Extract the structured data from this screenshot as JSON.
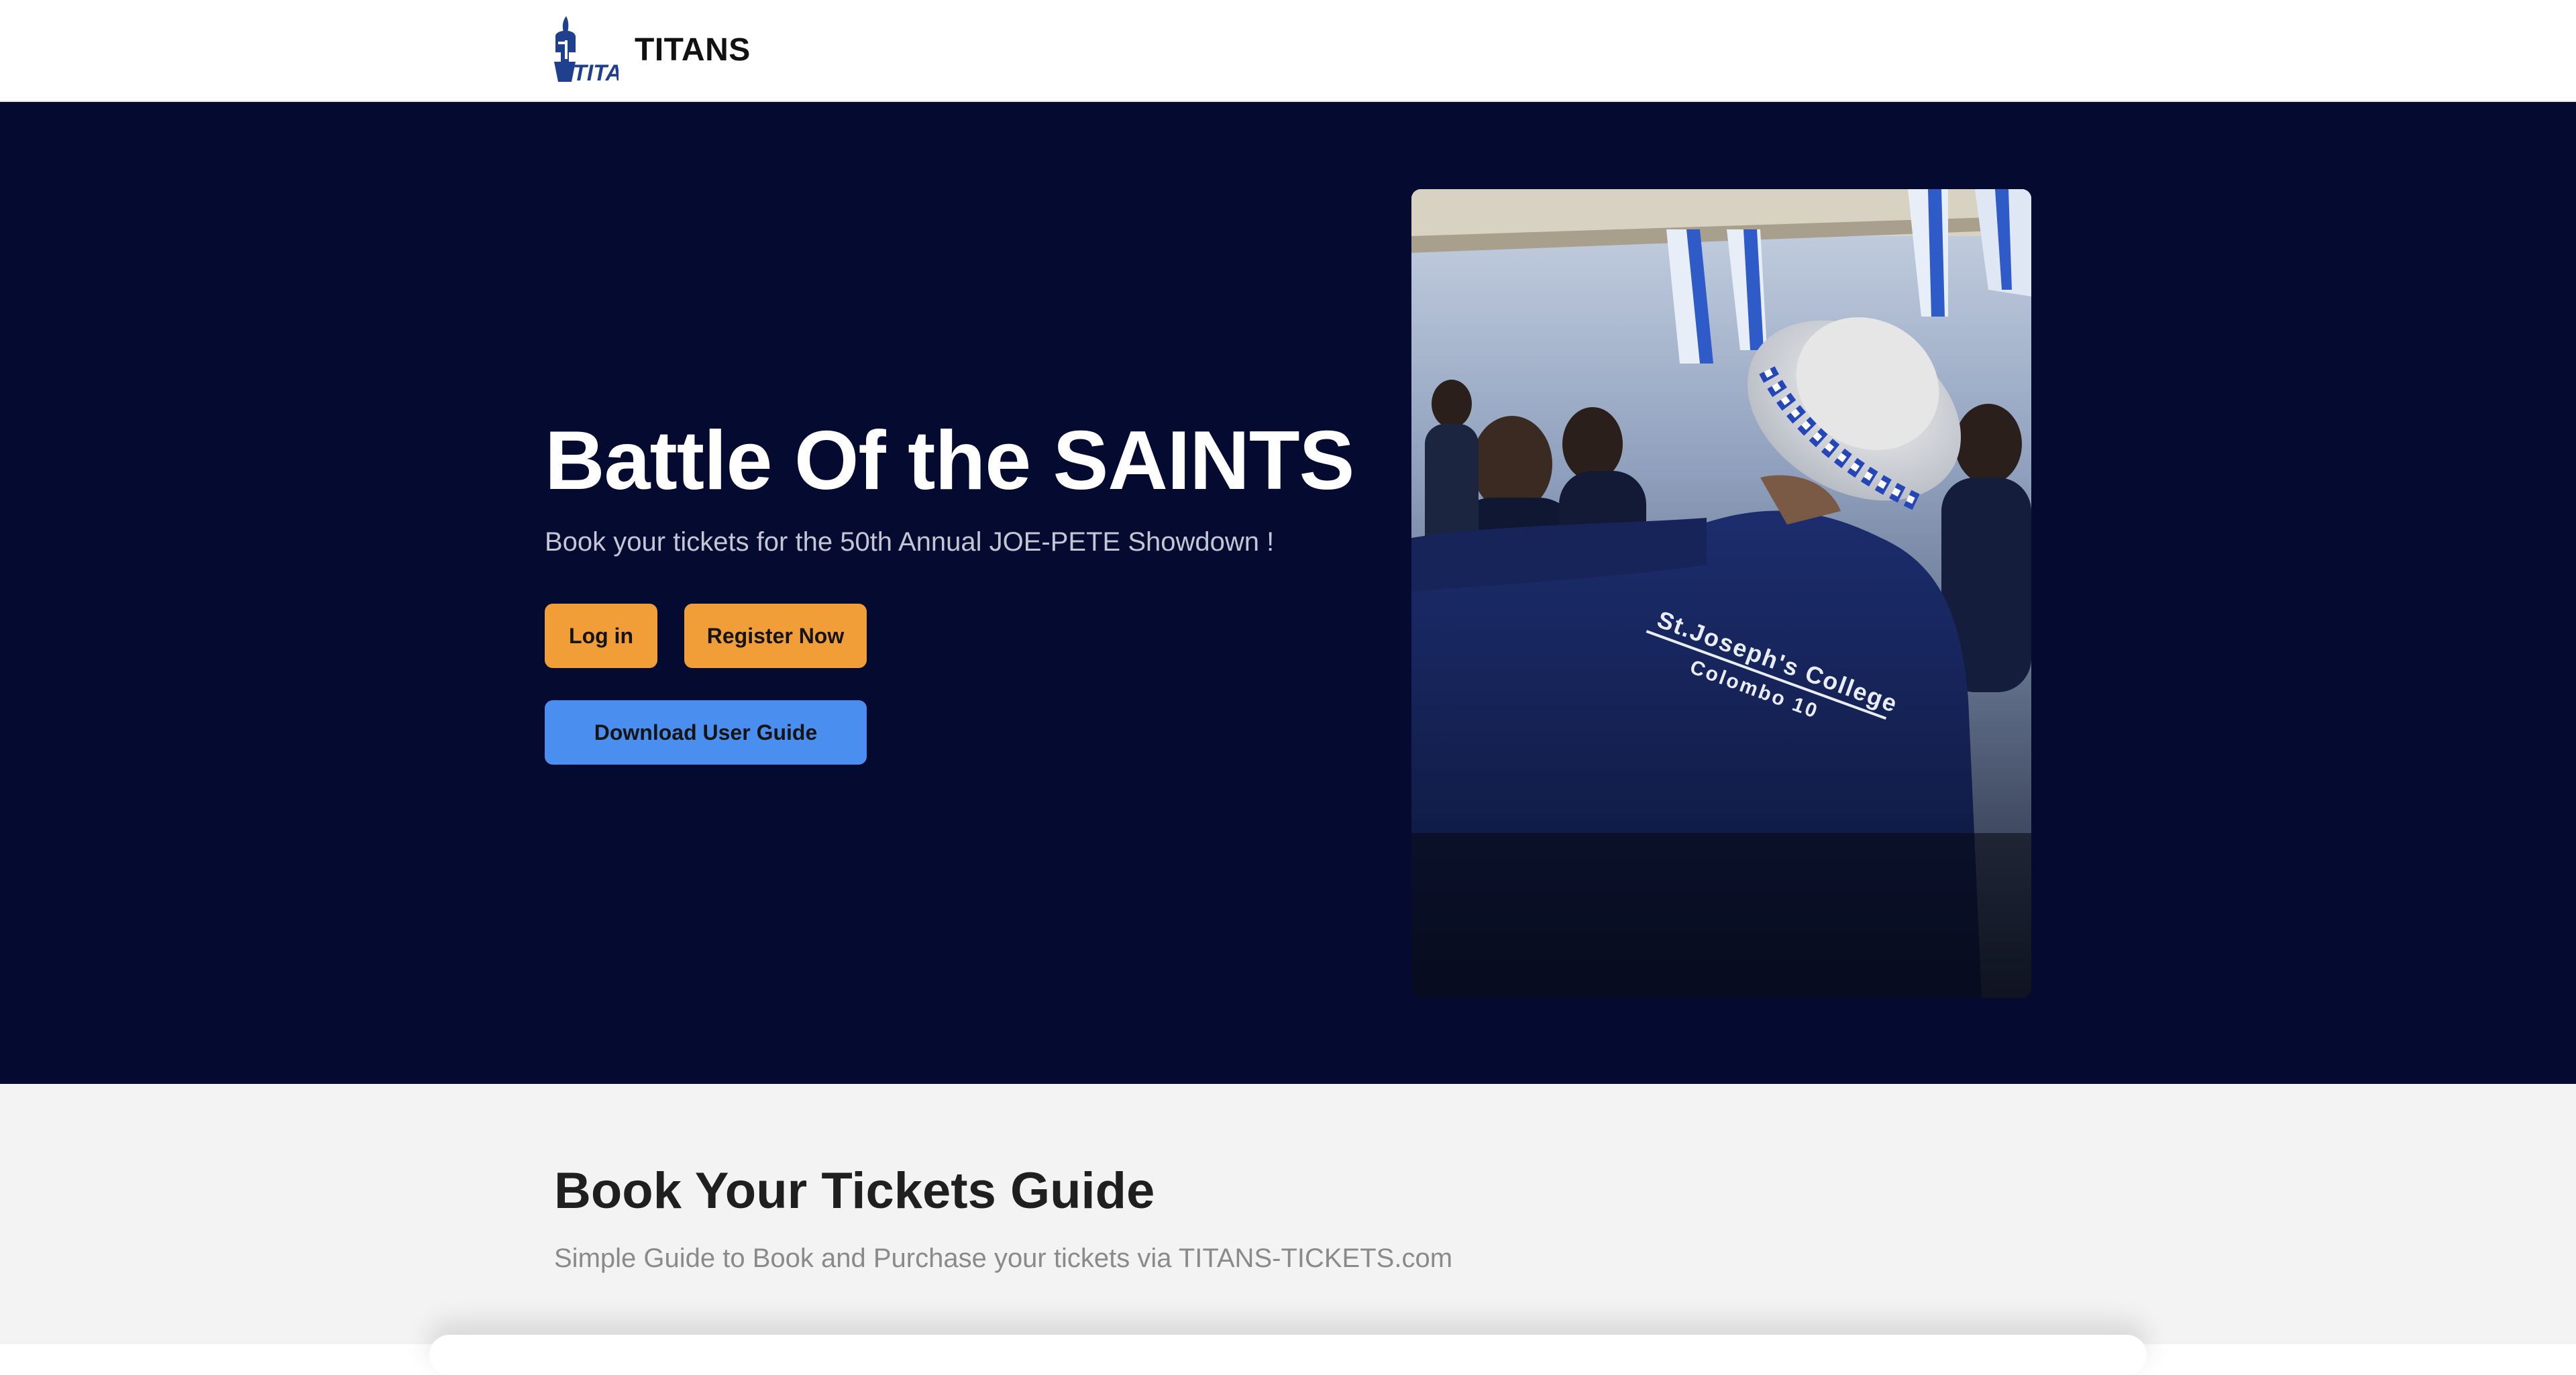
{
  "header": {
    "logo_text": "TITANS",
    "brand_name": "TITANS",
    "logo_icon": "spartan-helmet-icon"
  },
  "hero": {
    "title": "Battle Of the SAINTS",
    "subtitle": "Book your tickets for the 50th Annual JOE-PETE Showdown !",
    "login_label": "Log in",
    "register_label": "Register Now",
    "guide_label": "Download User Guide",
    "photo_jacket_line1": "St.Joseph's College",
    "photo_jacket_line2": "Colombo 10"
  },
  "guide": {
    "title": "Book Your Tickets Guide",
    "subtitle": "Simple Guide to Book and Purchase your tickets via TITANS-TICKETS.com"
  },
  "colors": {
    "hero_background": "#040a30",
    "primary_button": "#f19e38",
    "secondary_button": "#4a8ff0",
    "section_background": "#f3f3f3"
  }
}
